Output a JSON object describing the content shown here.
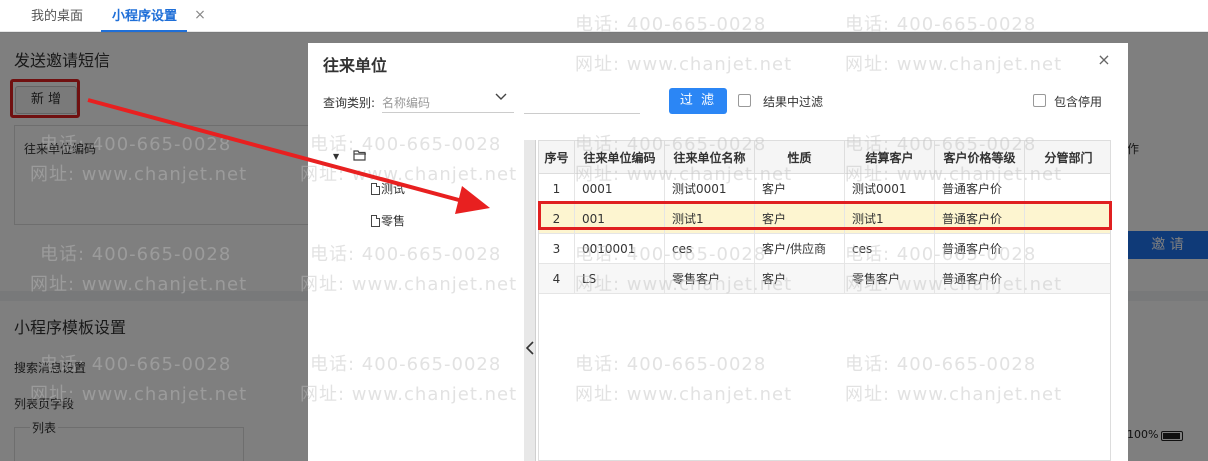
{
  "tabs": [
    {
      "label": "我的桌面"
    },
    {
      "label": "小程序设置",
      "close_icon": "×"
    }
  ],
  "background": {
    "title1": "发送邀请短信",
    "add_button": "新 增",
    "box_label": "往来单位编码",
    "right_col_label": "作",
    "invite_button": "邀 请",
    "title2": "小程序模板设置",
    "search_msg": "搜索消息设置",
    "list_field": "列表页字段",
    "list_label": "列表",
    "battery_text": "100%"
  },
  "dialog": {
    "title": "往来单位",
    "close_icon": "×",
    "query_label": "查询类别:",
    "query_select_value": "名称编码",
    "query_input_value": "",
    "filter_button": "过 滤",
    "filter_in_result_label": "结果中过滤",
    "include_disabled_label": "包含停用",
    "tree": {
      "nodes": [
        "测试",
        "零售"
      ]
    },
    "table": {
      "headers": [
        "序号",
        "往来单位编码",
        "往来单位名称",
        "性质",
        "结算客户",
        "客户价格等级",
        "分管部门"
      ],
      "rows": [
        [
          "1",
          "0001",
          "测试0001",
          "客户",
          "测试0001",
          "普通客户价",
          ""
        ],
        [
          "2",
          "001",
          "测试1",
          "客户",
          "测试1",
          "普通客户价",
          ""
        ],
        [
          "3",
          "0010001",
          "ces",
          "客户/供应商",
          "ces",
          "普通客户价",
          ""
        ],
        [
          "4",
          "LS",
          "零售客户",
          "客户",
          "零售客户",
          "普通客户价",
          ""
        ]
      ],
      "selected_row": 2
    }
  },
  "watermark": {
    "phone": "电话: 400-665-0028",
    "site": "网址: www.chanjet.net"
  },
  "colors": {
    "primary": "#2b86f5",
    "tab_active": "#1f6fd8",
    "annotation_red": "#e02020",
    "selected_row_bg": "#fdf5d0"
  }
}
